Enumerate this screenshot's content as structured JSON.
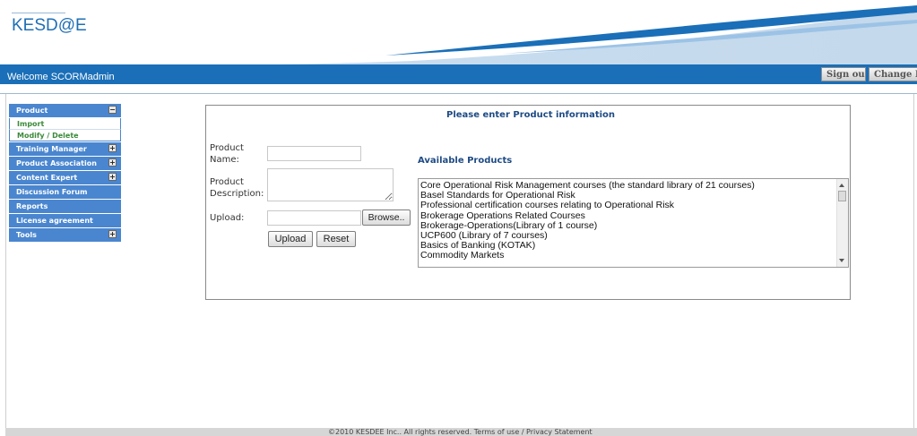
{
  "header": {
    "logo_text": "KESD@E",
    "welcome_text": "Welcome SCORMadmin",
    "sign_out_label": "Sign out",
    "change_password_label": "Change Passwor"
  },
  "sidebar": {
    "sections": [
      {
        "label": "Product",
        "toggle": "−",
        "subitems": [
          "Import",
          "Modify / Delete"
        ]
      },
      {
        "label": "Training Manager",
        "toggle": "+"
      },
      {
        "label": "Product Association",
        "toggle": "+"
      },
      {
        "label": "Content Expert",
        "toggle": "+"
      },
      {
        "label": "Discussion Forum"
      },
      {
        "label": "Reports"
      },
      {
        "label": "License agreement"
      },
      {
        "label": "Tools",
        "toggle": "+"
      }
    ]
  },
  "form": {
    "title": "Please enter Product information",
    "product_name_label_1": "Product",
    "product_name_label_2": "Name:",
    "product_name_value": "",
    "product_desc_label_1": "Product",
    "product_desc_label_2": "Description:",
    "product_desc_value": "",
    "upload_label": "Upload:",
    "browse_label": "Browse..",
    "upload_button": "Upload",
    "reset_button": "Reset"
  },
  "available": {
    "title": "Available Products",
    "items": [
      "Core Operational Risk Management courses (the standard library of 21 courses)",
      "Basel Standards for Operational Risk",
      "Professional certification courses relating to Operational Risk",
      "Brokerage Operations Related Courses",
      "Brokerage-Operations(Library of 1 course)",
      "UCP600 (Library of 7 courses)",
      "Basics of Banking (KOTAK)",
      "Commodity Markets"
    ]
  },
  "footer": {
    "text": "©2010 KESDEE Inc.. All rights reserved. Terms of use / Privacy Statement"
  },
  "colors": {
    "brand_blue": "#1f6fb5",
    "sidebar_blue": "#4a86cf",
    "title_blue": "#1e4b85"
  }
}
